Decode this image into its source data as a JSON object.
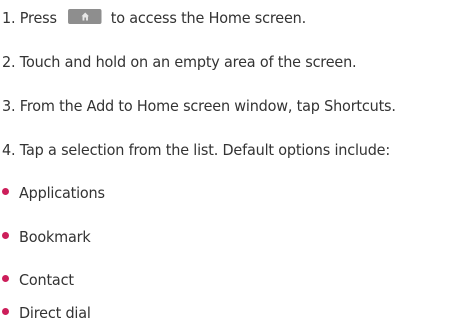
{
  "steps": [
    {
      "number": "1.",
      "before": "Press",
      "icon": "home-key-icon",
      "after": "to access the Home screen."
    },
    {
      "number": "2.",
      "text": "Touch and hold on an empty area of the screen."
    },
    {
      "number": "3.",
      "text": "From the Add to Home screen window, tap Shortcuts."
    },
    {
      "number": "4.",
      "text": "Tap a selection from the list. Default options include:"
    }
  ],
  "options": [
    "Applications",
    "Bookmark",
    "Contact",
    "Direct dial"
  ],
  "colors": {
    "text": "#333333",
    "bullet": "#cc1e5a",
    "home_key": "#8e8e8e"
  }
}
